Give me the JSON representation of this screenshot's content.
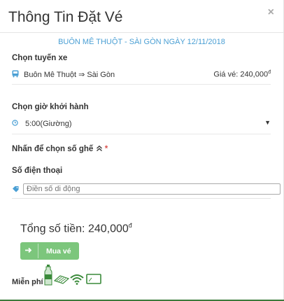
{
  "modal": {
    "title": "Thông Tin Đặt Vé",
    "close": "×",
    "route_banner": "BUÔN MÊ THUỘT - SÀI GÒN NGÀY 12/11/2018"
  },
  "route_section": {
    "label": "Chọn tuyến xe",
    "value": "Buôn Mê Thuột ⇒ Sài Gòn",
    "price_label": "Giá vé: 240,000",
    "currency": "đ",
    "icon": "bus-icon"
  },
  "time_section": {
    "label": "Chọn giờ khởi hành",
    "selected": "5:00(Giường)",
    "icon": "clock-icon"
  },
  "seat_section": {
    "label": "Nhấn để chọn số ghế",
    "required": "*"
  },
  "phone_section": {
    "label": "Số điện thoại",
    "placeholder": "Điền số di động",
    "icon": "tag-icon"
  },
  "summary": {
    "total_label": "Tổng số tiền: 240,000",
    "currency": "đ"
  },
  "buy_button": {
    "label": "Mua vé"
  },
  "amenities": {
    "label": "Miễn phí",
    "icons": [
      "water-bottle-icon",
      "towel-icon",
      "wifi-icon",
      "tv-icon"
    ]
  },
  "colors": {
    "accent": "#4a9fd4",
    "button": "#5cb85c",
    "required": "#d9534f"
  }
}
